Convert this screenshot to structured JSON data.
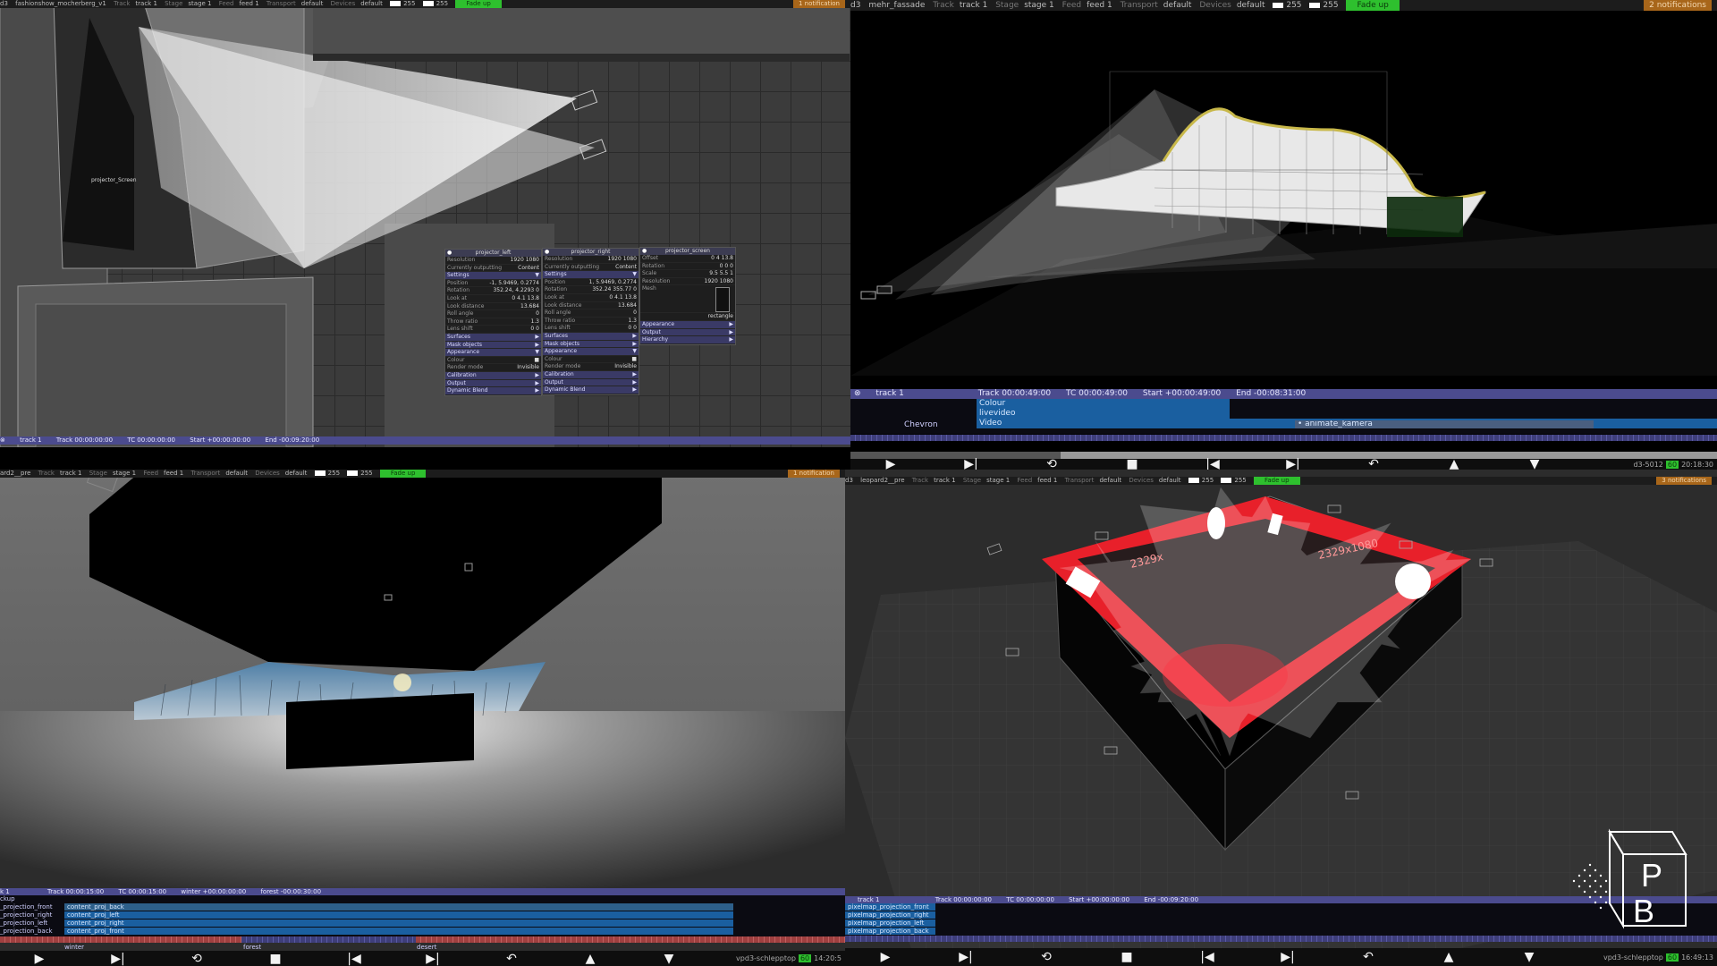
{
  "q1": {
    "hud": {
      "app": "d3",
      "project": "fashionshow_mocherberg_v1",
      "track_label": "Track",
      "track": "track 1",
      "stage_label": "Stage",
      "stage": "stage 1",
      "feed_label": "Feed",
      "feed": "feed 1",
      "transport_label": "Transport",
      "transport": "default",
      "devices_label": "Devices",
      "devices": "default",
      "val1": "255",
      "val2": "255",
      "fade": "Fade up",
      "notifications": "1 notification"
    },
    "screen_label": "projector_Screen",
    "panels": {
      "left": {
        "title": "projector_left",
        "resolution": [
          "Resolution",
          "1920",
          "1080"
        ],
        "outputting": [
          "Currently outputting",
          "Content"
        ],
        "settings": "Settings",
        "position": [
          "Position",
          "-1, 5.9469, 0.2774"
        ],
        "rotation": [
          "Rotation",
          "352.24, 4.2293",
          "0"
        ],
        "look_at": [
          "Look at",
          "0",
          "4.1",
          "13.8"
        ],
        "look_distance": [
          "Look distance",
          "13.684"
        ],
        "roll_angle": [
          "Roll angle",
          "0"
        ],
        "throw_ratio": [
          "Throw ratio",
          "1.3"
        ],
        "lens_shift": [
          "Lens shift",
          "0",
          "0"
        ],
        "surfaces": "Surfaces",
        "mask_objects": "Mask objects",
        "appearance": "Appearance",
        "colour": "Colour",
        "render_mode": [
          "Render mode",
          "Invisible"
        ],
        "calibration": "Calibration",
        "output": "Output",
        "dynamic_blend": "Dynamic Blend"
      },
      "right": {
        "title": "projector_right",
        "resolution": [
          "Resolution",
          "1920",
          "1080"
        ],
        "outputting": [
          "Currently outputting",
          "Content"
        ],
        "settings": "Settings",
        "position": [
          "Position",
          "1, 5.9469, 0.2774"
        ],
        "rotation": [
          "Rotation",
          "352.24",
          "355.77",
          "0"
        ],
        "look_at": [
          "Look at",
          "0",
          "4.1",
          "13.8"
        ],
        "look_distance": [
          "Look distance",
          "13.684"
        ],
        "roll_angle": [
          "Roll angle",
          "0"
        ],
        "throw_ratio": [
          "Throw ratio",
          "1.3"
        ],
        "lens_shift": [
          "Lens shift",
          "0",
          "0"
        ],
        "surfaces": "Surfaces",
        "mask_objects": "Mask objects",
        "appearance": "Appearance",
        "colour": "Colour",
        "render_mode": [
          "Render mode",
          "Invisible"
        ],
        "calibration": "Calibration",
        "output": "Output",
        "dynamic_blend": "Dynamic Blend"
      },
      "screen": {
        "title": "projector_screen",
        "offset": [
          "Offset",
          "0",
          "4",
          "13.8"
        ],
        "rotation": [
          "Rotation",
          "0",
          "0",
          "0"
        ],
        "scale": [
          "Scale",
          "9.5",
          "5.5",
          "1"
        ],
        "resolution": [
          "Resolution",
          "1920",
          "1080"
        ],
        "mesh": "Mesh",
        "mesh_value": "rectangle",
        "appearance": "Appearance",
        "output": "Output",
        "hierarchy": "Hierarchy"
      }
    },
    "timeline": {
      "track": "track 1",
      "track_tc": "Track 00:00:00:00",
      "tc": "TC 00:00:00:00",
      "start": "Start +00:00:00:00",
      "end": "End -00:09:20:00"
    }
  },
  "q2": {
    "hud": {
      "app": "d3",
      "project": "mehr_fassade",
      "track_label": "Track",
      "track": "track 1",
      "stage_label": "Stage",
      "stage": "stage 1",
      "feed_label": "Feed",
      "feed": "feed 1",
      "transport_label": "Transport",
      "transport": "default",
      "devices_label": "Devices",
      "devices": "default",
      "val1": "255",
      "val2": "255",
      "fade": "Fade up",
      "notifications": "2 notifications"
    },
    "timeline": {
      "track": "track 1",
      "track_tc": "Track 00:00:49:00",
      "tc": "TC 00:00:49:00",
      "start": "Start +00:00:49:00",
      "end": "End -00:08:31:00",
      "left_label": "Chevron",
      "layers": [
        "Colour",
        "livevideo",
        "Video"
      ],
      "clip": "animate_kamera"
    },
    "status": {
      "machine": "d3-5012",
      "fps": "60",
      "time": "20:18:30"
    }
  },
  "q3": {
    "hud": {
      "project": "ard2__pre",
      "track_label": "Track",
      "track": "track 1",
      "stage_label": "Stage",
      "stage": "stage 1",
      "feed_label": "Feed",
      "feed": "feed 1",
      "transport_label": "Transport",
      "transport": "default",
      "devices_label": "Devices",
      "devices": "default",
      "val1": "255",
      "val2": "255",
      "fade": "Fade up",
      "notifications": "1 notification"
    },
    "timeline": {
      "track": "k 1",
      "track_tc": "Track 00:00:15:00",
      "tc": "TC 00:00:15:00",
      "section": "winter +00:00:00:00",
      "next": "forest -00:00:30:00",
      "left_labels": [
        "ckup",
        "_projection_front",
        "_projection_right",
        "_projection_left",
        "_projection_back"
      ],
      "layers": [
        "content_proj_back",
        "content_proj_left",
        "content_proj_right",
        "content_proj_front"
      ],
      "markers": [
        "winter",
        "forest",
        "desert"
      ]
    },
    "status": {
      "machine": "vpd3-schlepptop",
      "fps": "60",
      "time": "14:20:5"
    }
  },
  "q4": {
    "hud": {
      "app": "d3",
      "project": "leopard2__pre",
      "track_label": "Track",
      "track": "track 1",
      "stage_label": "Stage",
      "stage": "stage 1",
      "feed_label": "Feed",
      "feed": "feed 1",
      "transport_label": "Transport",
      "transport": "default",
      "devices_label": "Devices",
      "devices": "default",
      "val1": "255",
      "val2": "255",
      "fade": "Fade up",
      "notifications": "3 notifications"
    },
    "canvas_labels": [
      "2329x",
      "2329x1080"
    ],
    "timeline": {
      "track": "track 1",
      "track_tc": "Track 00:00:00:00",
      "tc": "TC 00:00:00:00",
      "start": "Start +00:00:00:00",
      "end": "End -00:09:20:00",
      "layers": [
        "pixelmap_projection_front",
        "pixelmap_projection_right",
        "pixelmap_projection_left",
        "pixelmap_projection_back"
      ]
    },
    "status": {
      "machine": "vpd3-schlepptop",
      "fps": "60",
      "time": "16:49:13"
    }
  },
  "watermark": {
    "letters": [
      "P",
      "B"
    ]
  },
  "colors": {
    "hud_bg": "#1c1c1c",
    "fade_green": "#2ec02e",
    "notification_orange": "#a8661a",
    "timeline_purple": "#4b4b8e",
    "layer_blue": "#1a5fa0",
    "stage_red": "#e8202a"
  },
  "transport_icons": [
    "play-icon",
    "play-to-end-icon",
    "loop-icon",
    "stop-icon",
    "skip-back-icon",
    "skip-forward-icon",
    "return-icon",
    "up-icon",
    "down-icon"
  ]
}
